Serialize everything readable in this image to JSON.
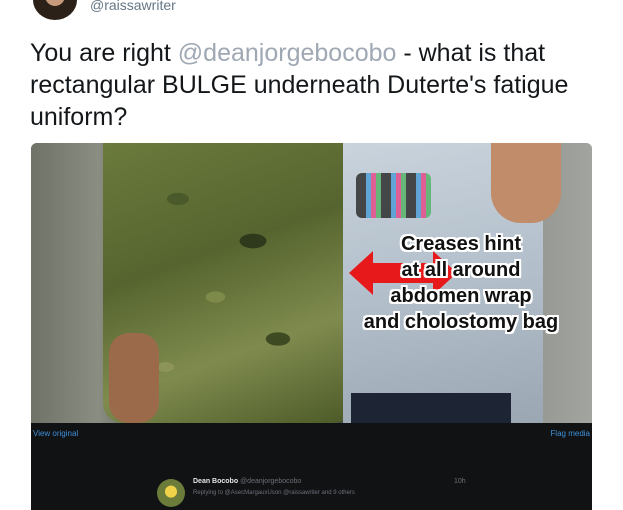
{
  "author": {
    "handle": "@raissawriter"
  },
  "tweet": {
    "text_pre": "You are right ",
    "mention": "@deanjorgebocobo",
    "text_post": " - what is that  rectangular BULGE underneath Duterte's fatigue uniform?"
  },
  "photo": {
    "annotation_lines": [
      "Creases hint",
      "at all around",
      "abdomen wrap",
      "and cholostomy bag"
    ]
  },
  "media_bar": {
    "view_original": "View original",
    "flag_media": "Flag media"
  },
  "reply": {
    "name": "Dean Bocobo",
    "handle": "@deanjorgebocobo",
    "replying_to": "Replying to @AsecMargauxUson @raissawriter and 9 others",
    "time": "10h"
  },
  "colors": {
    "mention": "#9fa8b3",
    "link": "#3f8fd8",
    "arrow": "#e8191b"
  }
}
